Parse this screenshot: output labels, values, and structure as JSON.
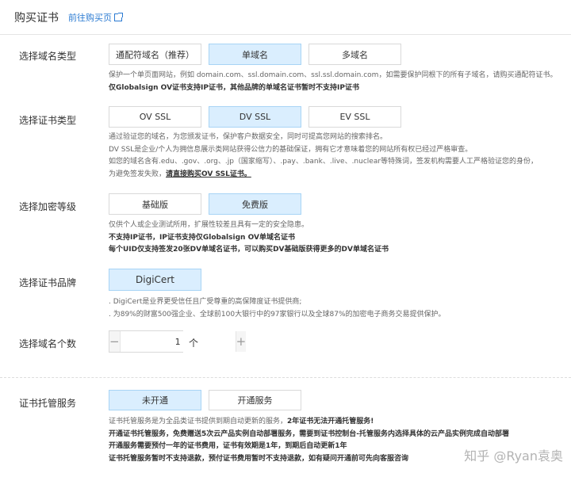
{
  "header": {
    "title": "购买证书",
    "link": "前往购买页"
  },
  "domain_type": {
    "label": "选择域名类型",
    "options": [
      "通配符域名（推荐）",
      "单域名",
      "多域名"
    ],
    "desc": [
      "保护一个单页面网站，例如 domain.com、ssl.domain.com、ssl.ssl.domain.com，如需要保护同根下的所有子域名，请购买通配符证书。",
      "仅Globalsign OV证书支持IP证书，其他品牌的单域名证书暂时不支持IP证书"
    ]
  },
  "cert_type": {
    "label": "选择证书类型",
    "options": [
      "OV SSL",
      "DV SSL",
      "EV SSL"
    ],
    "desc": [
      "通过验证您的域名，为您颁发证书，保护客户数据安全，同时可提高您网站的搜索排名。",
      "DV SSL是企业/个人为拥信息展示类网站获得公信力的基础保证，拥有它才意味着您的网站所有权已经过严格审查。",
      "如您的域名含有.edu、.gov、.org、.jp（国家缩写）、.pay、.bank、.live、.nuclear等特殊词，签发机构需要人工严格验证您的身份，",
      "为避免签发失败，",
      "请直接购买OV SSL证书。"
    ]
  },
  "encrypt": {
    "label": "选择加密等级",
    "options": [
      "基础版",
      "免费版"
    ],
    "desc": [
      "仅供个人或企业测试所用，扩展性较差且具有一定的安全隐患。",
      "不支持IP证书，IP证书支持仅Globalsign OV单域名证书",
      "每个UID仅支持签发20张DV单域名证书，可以购买DV基础版获得更多的DV单域名证书"
    ]
  },
  "brand": {
    "label": "选择证书品牌",
    "options": [
      "DigiCert"
    ],
    "desc": [
      ". DigiCert是业界更受信任且广受尊重的高保障度证书提供商;",
      ". 为89%的财富500强企业、全球前100大银行中的97家银行以及全球87%的加密电子商务交易提供保护。"
    ]
  },
  "domain_count": {
    "label": "选择域名个数",
    "value": "1",
    "minus": "−",
    "plus": "+",
    "unit": "个"
  },
  "hosting": {
    "label": "证书托管服务",
    "options": [
      "未开通",
      "开通服务"
    ],
    "desc": [
      "证书托管服务是为全品类证书提供到期自动更新的服务，",
      "2年证书无法开通托管服务!",
      "开通证书托管服务，免费赠送5次云产品实例自动部署服务，需要到证书控制台-托管服务内选择具体的云产品实例完成自动部署",
      "开通服务需要预付一年的证书费用，证书有效期是1年，到期后自动更新1年",
      "证书托管服务暂时不支持退款，预付证书费用暂时不支持退款，如有疑问开通前可先向客服咨询"
    ]
  },
  "watermark": "知乎 @Ryan袁奥"
}
